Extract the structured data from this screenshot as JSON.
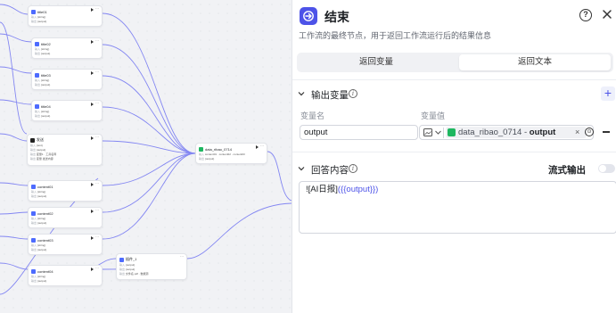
{
  "canvas": {
    "nodes": [
      {
        "id": "n1",
        "title": "title01",
        "rows": [
          [
            "输入",
            "{string}"
          ],
          [
            "输出",
            "{output}"
          ]
        ]
      },
      {
        "id": "n2",
        "title": "title02",
        "rows": [
          [
            "输入",
            "{string}"
          ],
          [
            "输出",
            "{output}"
          ]
        ]
      },
      {
        "id": "n3",
        "title": "title03",
        "rows": [
          [
            "输入",
            "{string}"
          ],
          [
            "输出",
            "{output}"
          ]
        ]
      },
      {
        "id": "n4",
        "title": "title04",
        "rows": [
          [
            "输入",
            "{string}"
          ],
          [
            "输出",
            "{output}"
          ]
        ]
      },
      {
        "id": "n5",
        "title": "发送",
        "rows": [
          [
            "输入",
            "{text}"
          ],
          [
            "输出",
            "{output}"
          ],
          [
            "输出",
            "变量1 · 工具名称"
          ],
          [
            "输出",
            "变量 发送内容"
          ]
        ]
      },
      {
        "id": "n6",
        "title": "content01",
        "rows": [
          [
            "输入",
            "{string}"
          ],
          [
            "输出",
            "{output}"
          ]
        ]
      },
      {
        "id": "n7",
        "title": "content02",
        "rows": [
          [
            "输入",
            "{string}"
          ],
          [
            "输出",
            "{output}"
          ]
        ]
      },
      {
        "id": "n8",
        "title": "content03",
        "rows": [
          [
            "输入",
            "{string}"
          ],
          [
            "输出",
            "{output}"
          ]
        ]
      },
      {
        "id": "n9",
        "title": "content04",
        "rows": [
          [
            "输入",
            "{string}"
          ],
          [
            "输出",
            "{output}"
          ]
        ]
      },
      {
        "id": "n10",
        "title": "data_ribao_0714",
        "rows": [
          [
            "输入",
            "content01 · content02 · content03"
          ],
          [
            "输出",
            "{output}"
          ]
        ]
      },
      {
        "id": "n11",
        "title": "插件_1",
        "rows": [
          [
            "输入",
            "{output}"
          ],
          [
            "输出",
            "{output}"
          ],
          [
            "输出",
            "文件名.pdf · 数据源"
          ]
        ]
      }
    ]
  },
  "panel": {
    "title": "结束",
    "description": "工作流的最终节点，用于返回工作流运行后的结果信息",
    "tabs": [
      "返回变量",
      "返回文本"
    ],
    "active_tab": "返回文本",
    "output_section": {
      "title": "输出变量",
      "name_label": "变量名",
      "value_label": "变量值",
      "row": {
        "name": "output",
        "source_node": "data_ribao_0714",
        "separator": " - ",
        "source_var": "output"
      }
    },
    "answer_section": {
      "title": "回答内容",
      "stream_label": "流式输出",
      "stream_enabled": false,
      "content_prefix": "![AI日报]",
      "content_var": "({{output}})"
    }
  },
  "colors": {
    "accent": "#4d53e8",
    "node_green": "#1eb760",
    "edge": "#6b6ff0"
  }
}
